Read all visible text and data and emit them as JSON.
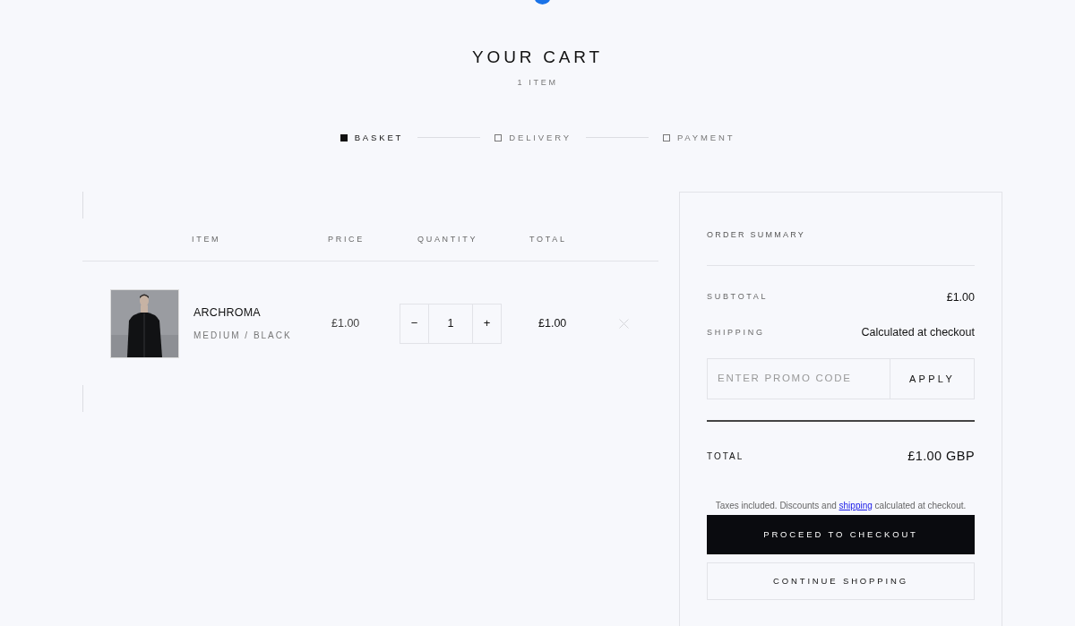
{
  "header": {
    "title": "YOUR CART",
    "count": "1 ITEM"
  },
  "steps": [
    {
      "label": "BASKET",
      "selected": true
    },
    {
      "label": "DELIVERY",
      "selected": false
    },
    {
      "label": "PAYMENT",
      "selected": false
    }
  ],
  "table": {
    "columns": [
      "ITEM",
      "PRICE",
      "QUANTITY",
      "TOTAL"
    ],
    "rows": [
      {
        "name": "ARCHROMA",
        "variant": "MEDIUM / BLACK",
        "price": "£1.00",
        "quantity": "1",
        "decrement": "−",
        "increment": "+",
        "total": "£1.00"
      }
    ]
  },
  "summary": {
    "title": "ORDER SUMMARY",
    "lines": [
      {
        "label": "SUBTOTAL",
        "value": "£1.00"
      },
      {
        "label": "SHIPPING",
        "value": "Calculated at checkout"
      }
    ],
    "promo": {
      "placeholder": "ENTER PROMO CODE",
      "button": "APPLY"
    },
    "total": {
      "label": "TOTAL",
      "value": "£1.00 GBP"
    },
    "note": {
      "before": "Taxes included. Discounts and ",
      "link": "shipping",
      "after": " calculated at checkout."
    },
    "checkout": "PROCEED TO CHECKOUT",
    "continue": "CONTINUE SHOPPING"
  }
}
